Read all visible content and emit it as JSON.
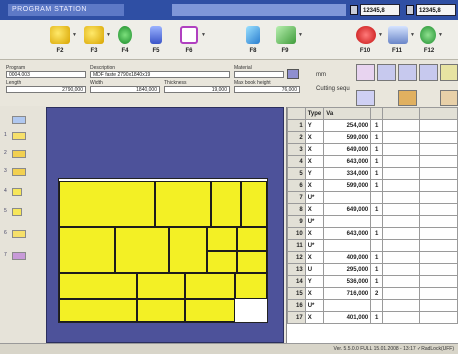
{
  "window": {
    "title": "PROGRAM STATION",
    "field_a": "12345,8",
    "field_b": "12345,8"
  },
  "toolbar": {
    "left_labels": [
      "F2",
      "F3",
      "F4",
      "F5",
      "F6",
      "F8",
      "F9"
    ],
    "right_labels": [
      "F10",
      "F11",
      "F12"
    ]
  },
  "params": {
    "program_label": "Program",
    "program_value": "0004.003",
    "description_label": "Description",
    "description_value": "MDF faste 2790x1840x19",
    "material_label": "Material",
    "material_value": "",
    "length_label": "Length",
    "length_value": "2790,000",
    "width_label": "Width",
    "width_value": "1840,000",
    "thickness_label": "Thickness",
    "thickness_value": "19,000",
    "max_book_label": "Max book height",
    "max_book_value": "76,000",
    "unit": "mm",
    "cutting_label": "Cutting sequ"
  },
  "strip_numbers": [
    "1",
    "2",
    "3",
    "4",
    "5",
    "6",
    "7"
  ],
  "table": {
    "headers": [
      "",
      "Type",
      "Va",
      "",
      "",
      ""
    ],
    "rows": [
      {
        "n": "1",
        "t": "Y",
        "v": "254,000",
        "c": "1"
      },
      {
        "n": "2",
        "t": "X",
        "v": "599,000",
        "c": "1"
      },
      {
        "n": "3",
        "t": "X",
        "v": "649,000",
        "c": "1"
      },
      {
        "n": "4",
        "t": "X",
        "v": "643,000",
        "c": "1"
      },
      {
        "n": "5",
        "t": "Y",
        "v": "334,000",
        "c": "1"
      },
      {
        "n": "6",
        "t": "X",
        "v": "599,000",
        "c": "1"
      },
      {
        "n": "7",
        "t": "U*",
        "v": "",
        "c": ""
      },
      {
        "n": "8",
        "t": "X",
        "v": "649,000",
        "c": "1"
      },
      {
        "n": "9",
        "t": "U*",
        "v": "",
        "c": ""
      },
      {
        "n": "10",
        "t": "X",
        "v": "643,000",
        "c": "1"
      },
      {
        "n": "11",
        "t": "U*",
        "v": "",
        "c": ""
      },
      {
        "n": "12",
        "t": "X",
        "v": "409,000",
        "c": "1"
      },
      {
        "n": "13",
        "t": "U",
        "v": "295,000",
        "c": "1"
      },
      {
        "n": "14",
        "t": "Y",
        "v": "536,000",
        "c": "1"
      },
      {
        "n": "15",
        "t": "X",
        "v": "716,000",
        "c": "2"
      },
      {
        "n": "16",
        "t": "U*",
        "v": "",
        "c": ""
      },
      {
        "n": "17",
        "t": "X",
        "v": "401,000",
        "c": "1"
      }
    ]
  },
  "status": {
    "text": "Ver. 5.5.0.0 FULL 15.01.2008 - 13:17  ✓RadLock(UFF)"
  },
  "colors": {
    "piece": "#f3f025",
    "canvas": "#4d529a",
    "title": "#2f4fa4"
  }
}
